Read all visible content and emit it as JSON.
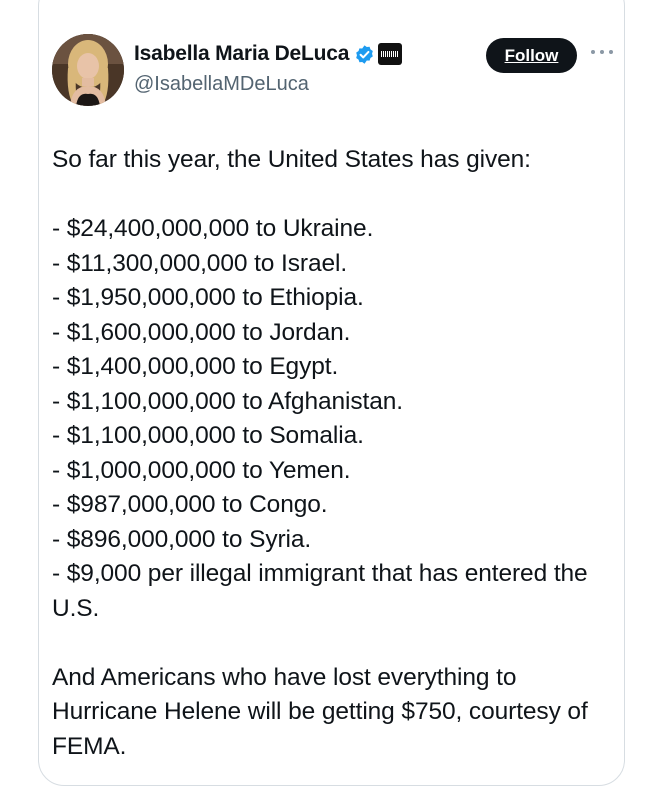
{
  "author": {
    "display_name": "Isabella Maria DeLuca",
    "handle": "@IsabellaMDeLuca",
    "verified_icon": "verified-badge-icon",
    "affiliate_icon": "affiliate-badge-icon",
    "brand_color": "#1d9bf0"
  },
  "actions": {
    "follow_label": "Follow",
    "more_icon": "more-dots-icon"
  },
  "tweet": {
    "intro": "So far this year, the United States has given:",
    "items": [
      "- $24,400,000,000 to Ukraine.",
      "- $11,300,000,000 to Israel.",
      "- $1,950,000,000 to Ethiopia.",
      "- $1,600,000,000 to Jordan.",
      "- $1,400,000,000 to Egypt.",
      "- $1,100,000,000 to Afghanistan.",
      "- $1,100,000,000 to Somalia.",
      "- $1,000,000,000 to Yemen.",
      "- $987,000,000 to Congo.",
      "- $896,000,000 to Syria.",
      "- $9,000 per illegal immigrant that has entered the U.S."
    ],
    "closing": "And Americans who have lost everything to Hurricane Helene will be getting $750, courtesy of FEMA."
  }
}
